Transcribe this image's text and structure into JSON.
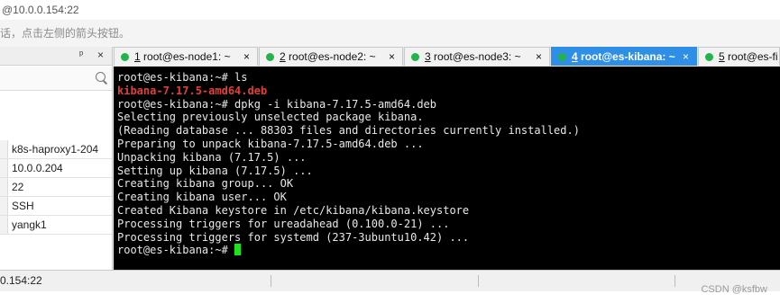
{
  "window": {
    "title": "@10.0.0.154:22"
  },
  "hint": {
    "text": "话，点击左侧的箭头按钮。"
  },
  "sidebar": {
    "search_placeholder": "",
    "properties": [
      "k8s-haproxy1-204",
      "10.0.0.204",
      "22",
      "SSH",
      "yangk1"
    ]
  },
  "tabs": [
    {
      "number": "1",
      "label": " root@es-node1: ~",
      "active": false
    },
    {
      "number": "2",
      "label": " root@es-node2: ~",
      "active": false
    },
    {
      "number": "3",
      "label": " root@es-node3: ~",
      "active": false
    },
    {
      "number": "4",
      "label": " root@es-kibana: ~",
      "active": true
    },
    {
      "number": "5",
      "label": " root@es-fi",
      "active": false
    }
  ],
  "tab_close_glyph": "×",
  "terminal": {
    "lines": [
      "root@es-kibana:~# ls",
      "kibana-7.17.5-amd64.deb",
      "root@es-kibana:~# dpkg -i kibana-7.17.5-amd64.deb",
      "Selecting previously unselected package kibana.",
      "(Reading database ... 88303 files and directories currently installed.)",
      "Preparing to unpack kibana-7.17.5-amd64.deb ...",
      "Unpacking kibana (7.17.5) ...",
      "Setting up kibana (7.17.5) ...",
      "Creating kibana group... OK",
      "Creating kibana user... OK",
      "Created Kibana keystore in /etc/kibana/kibana.keystore",
      "Processing triggers for ureadahead (0.100.0-21) ...",
      "Processing triggers for systemd (237-3ubuntu10.42) ...",
      "root@es-kibana:~# "
    ],
    "colors": {
      "background": "#000000",
      "text": "#e8e8e8",
      "highlight": "#e0403a",
      "cursor": "#19e619"
    }
  },
  "status": {
    "text": "0.154:22"
  },
  "watermark": {
    "text": "CSDN @ksfbw"
  },
  "colors": {
    "active_tab": "#2f8fe6",
    "session_dot": "#22b34a"
  }
}
